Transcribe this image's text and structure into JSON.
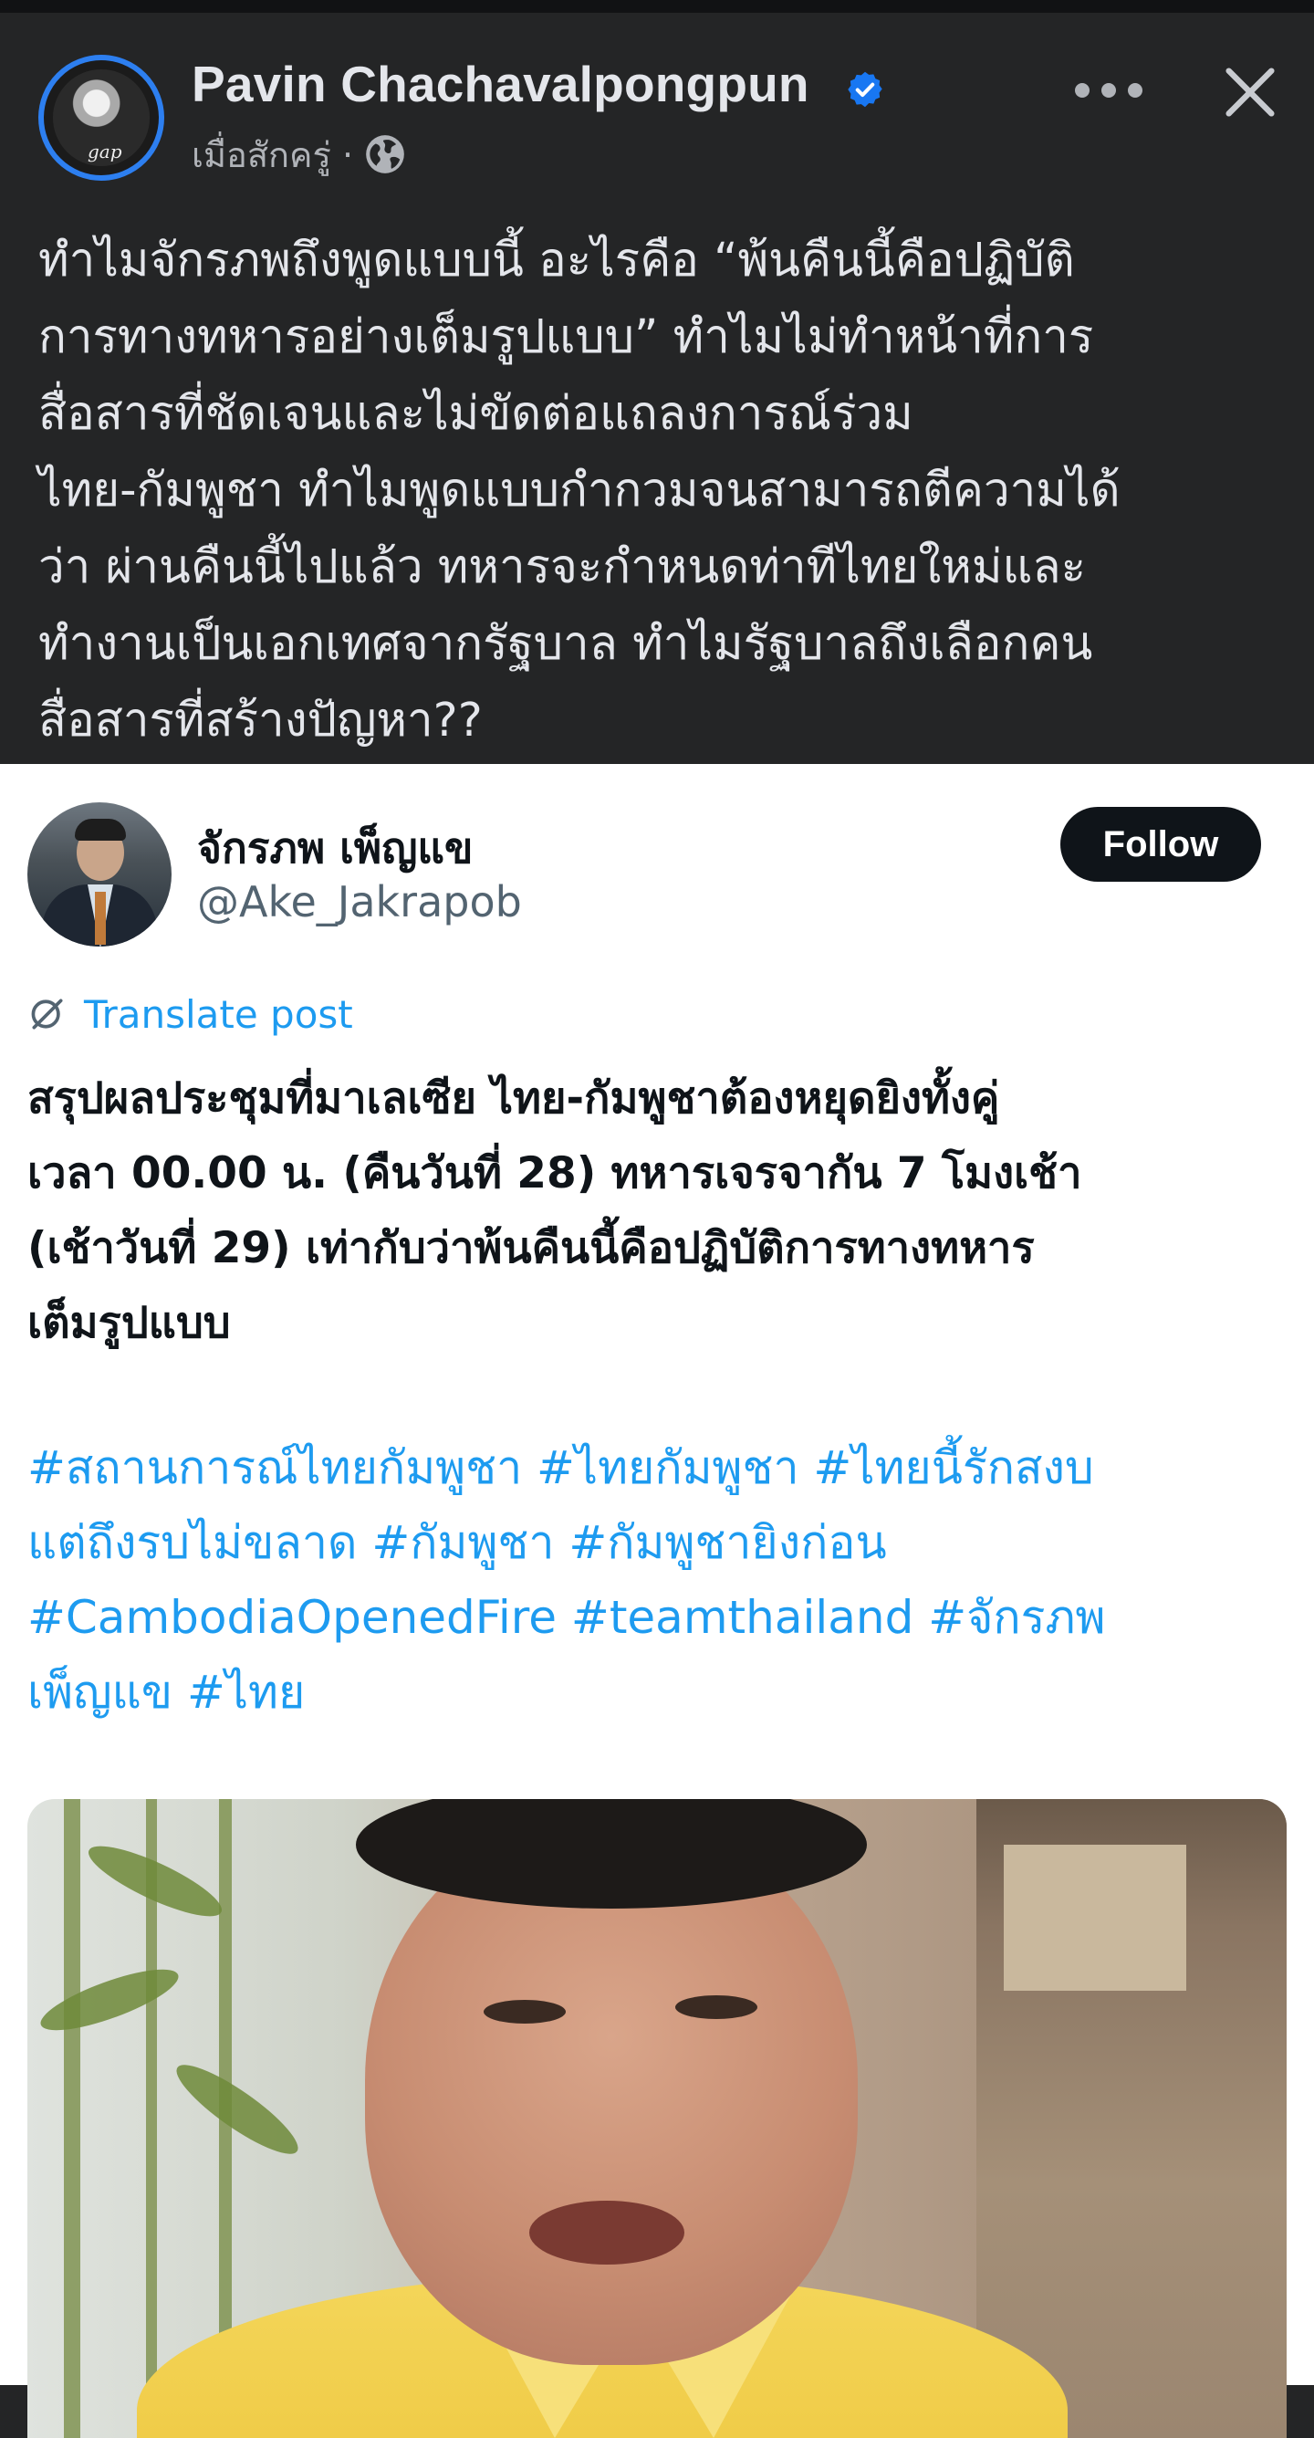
{
  "facebook_post": {
    "author": "Pavin Chachavalpongpun",
    "timestamp": "เมื่อสักครู่ ·",
    "audience_icon": "globe-icon",
    "text_lines": [
      "ทำไมจักรภพถึงพูดแบบนี้ อะไรคือ “พ้นคืนนี้คือปฏิบัติ",
      "การทางทหารอย่างเต็มรูปแบบ” ทำไมไม่ทำหน้าที่การ",
      "สื่อสารที่ชัดเจนและไม่ขัดต่อแถลงการณ์ร่วม",
      "ไทย-กัมพูชา ทำไมพูดแบบกำกวมจนสามารถตีความได้",
      "ว่า ผ่านคืนนี้ไปแล้ว ทหารจะกำหนดท่าทีไทยใหม่และ",
      "ทำงานเป็นเอกเทศจากรัฐบาล ทำไมรัฐบาลถึงเลือกคน",
      "สื่อสารที่สร้างปัญหา??"
    ]
  },
  "embedded_tweet": {
    "display_name": "จักรภพ เพ็ญแข",
    "handle": "@Ake_Jakrapob",
    "follow_label": "Follow",
    "translate_label": "Translate post",
    "text_lines": [
      "สรุปผลประชุมที่มาเลเซีย ไทย-กัมพูชาต้องหยุดยิงทั้งคู่",
      "เวลา 00.00 น. (คืนวันที่ 28) ทหารเจรจากัน 7 โมงเช้า",
      "(เช้าวันที่ 29) เท่ากับว่าพ้นคืนนี้คือปฏิบัติการทางทหาร",
      "เต็มรูปแบบ"
    ],
    "hashtag_lines": [
      "#สถานการณ์ไทยกัมพูชา #ไทยกัมพูชา #ไทยนี้รักสงบ",
      "แต่ถึงรบไม่ขลาด #กัมพูชา #กัมพูชายิงก่อน",
      "#CambodiaOpenedFire #teamthailand #จักรภพ",
      "เพ็ญแข #ไทย"
    ]
  },
  "colors": {
    "fb_background": "#242526",
    "fb_text": "#e4e6eb",
    "fb_secondary": "#b0b3b8",
    "verified_blue": "#1877f2",
    "tweet_link": "#1d9bf0",
    "follow_button": "#0f1419"
  }
}
